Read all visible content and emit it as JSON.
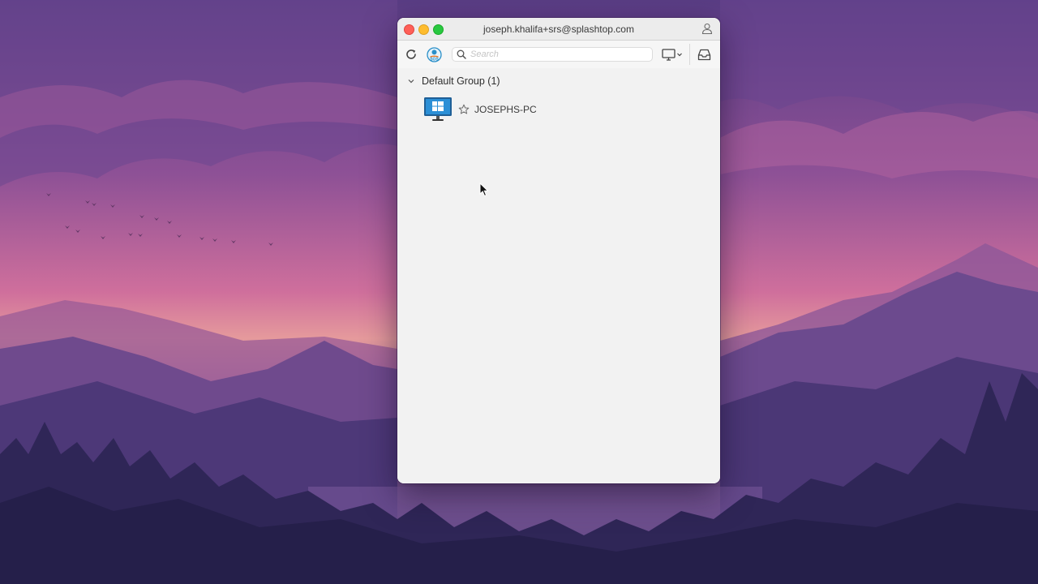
{
  "window": {
    "title": "joseph.khalifa+srs@splashtop.com"
  },
  "toolbar": {
    "refresh_icon": "refresh-icon",
    "sos_icon": "sos-icon",
    "sos_label": "SOS",
    "search_placeholder": "Search",
    "search_value": "",
    "view_icon": "monitor-view-icon",
    "inbox_icon": "inbox-icon"
  },
  "groups": [
    {
      "label": "Default Group (1)",
      "expanded": true,
      "devices": [
        {
          "name": "JOSEPHS-PC",
          "os_icon": "windows-monitor-icon",
          "favorite": false
        }
      ]
    }
  ]
}
